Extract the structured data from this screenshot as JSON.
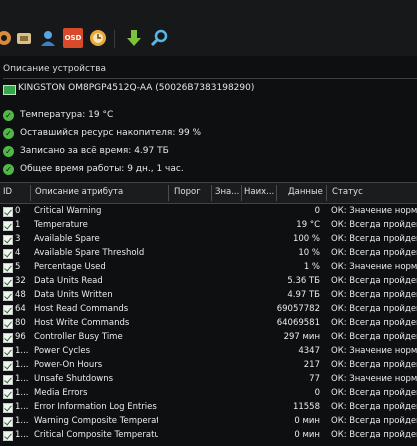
{
  "toolbar": {
    "icons": [
      "settings-icon",
      "users-icon",
      "osd-icon",
      "clock-icon",
      "download-icon",
      "search-icon"
    ],
    "osd_label": "OSD"
  },
  "device_section": {
    "title": "Описание устройства",
    "device": "KINGSTON OM8PGP4512Q-AA (50026B7383198290)"
  },
  "status": [
    "Температура: 19 °C",
    "Оставшийся ресурс накопителя: 99 %",
    "Записано за всё время: 4.97 ТБ",
    "Общее время работы: 9 дн., 1 час."
  ],
  "table": {
    "headers": {
      "id": "ID",
      "name": "Описание атрибута",
      "threshold": "Порог",
      "value": "Зна...",
      "worst": "Наих...",
      "data": "Данные",
      "status": "Статус"
    },
    "rows": [
      {
        "id": "0",
        "name": "Critical Warning",
        "data": "0",
        "status": "ОК: Значение норма"
      },
      {
        "id": "1",
        "name": "Temperature",
        "data": "19 °C",
        "status": "ОК: Всегда пройдено"
      },
      {
        "id": "3",
        "name": "Available Spare",
        "data": "100 %",
        "status": "ОК: Всегда пройдено"
      },
      {
        "id": "4",
        "name": "Available Spare Threshold",
        "data": "10 %",
        "status": "ОК: Всегда пройдено"
      },
      {
        "id": "5",
        "name": "Percentage Used",
        "data": "1 %",
        "status": "ОК: Значение норма"
      },
      {
        "id": "32",
        "name": "Data Units Read",
        "data": "5.36 ТБ",
        "status": "ОК: Всегда пройдено"
      },
      {
        "id": "48",
        "name": "Data Units Written",
        "data": "4.97 ТБ",
        "status": "ОК: Всегда пройдено"
      },
      {
        "id": "64",
        "name": "Host Read Commands",
        "data": "69057782",
        "status": "ОК: Всегда пройдено"
      },
      {
        "id": "80",
        "name": "Host Write Commands",
        "data": "64069581",
        "status": "ОК: Всегда пройдено"
      },
      {
        "id": "96",
        "name": "Controller Busy Time",
        "data": "297 мин",
        "status": "ОК: Всегда пройдено"
      },
      {
        "id": "1...",
        "name": "Power Cycles",
        "data": "4347",
        "status": "ОК: Значение норма"
      },
      {
        "id": "1...",
        "name": "Power-On Hours",
        "data": "217",
        "status": "ОК: Всегда пройдено"
      },
      {
        "id": "1...",
        "name": "Unsafe Shutdowns",
        "data": "77",
        "status": "ОК: Значение норма"
      },
      {
        "id": "1...",
        "name": "Media Errors",
        "data": "0",
        "status": "ОК: Всегда пройдено"
      },
      {
        "id": "1...",
        "name": "Error Information Log Entries",
        "data": "11558",
        "status": "ОК: Всегда пройдено"
      },
      {
        "id": "1...",
        "name": "Warning Composite Temperat...",
        "data": "0 мин",
        "status": "ОК: Всегда пройдено"
      },
      {
        "id": "1...",
        "name": "Critical Composite Temperatu...",
        "data": "0 мин",
        "status": "ОК: Всегда пройдено"
      }
    ]
  }
}
